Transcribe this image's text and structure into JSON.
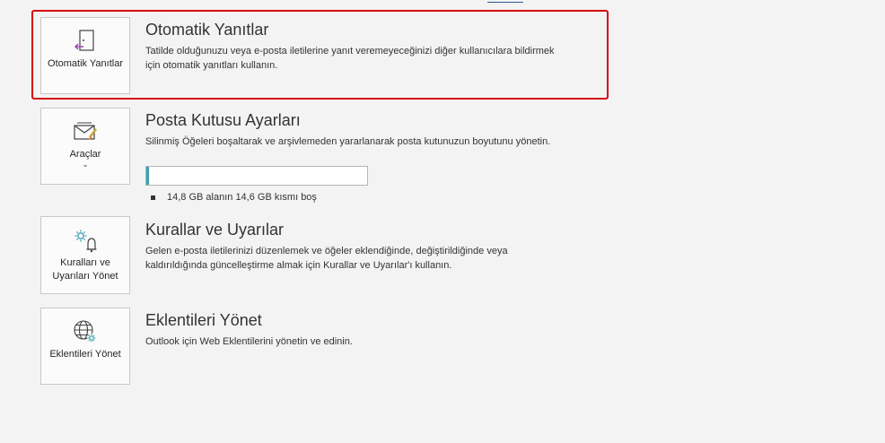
{
  "sections": [
    {
      "tile_label": "Otomatik Yanıtlar",
      "title": "Otomatik Yanıtlar",
      "description": "Tatilde olduğunuzu veya e-posta iletilerine yanıt veremeyeceğinizi diğer kullanıcılara bildirmek için otomatik yanıtları kullanın.",
      "icon": "auto-reply-door-icon"
    },
    {
      "tile_label": "Araçlar",
      "title": "Posta Kutusu Ayarları",
      "description": "Silinmiş Öğeleri boşaltarak ve arşivlemeden yararlanarak posta kutunuzun boyutunu yönetin.",
      "icon": "mailbox-tools-icon",
      "has_dropdown": true,
      "usage_text": "14,8 GB alanın 14,6 GB kısmı boş",
      "usage_fraction": 0.014
    },
    {
      "tile_label": "Kuralları ve Uyarıları Yönet",
      "title": "Kurallar ve Uyarılar",
      "description": "Gelen e-posta iletilerinizi düzenlemek ve öğeler eklendiğinde, değiştirildiğinde veya kaldırıldığında güncelleştirme almak için Kurallar ve Uyarılar'ı kullanın.",
      "icon": "rules-alerts-icon"
    },
    {
      "tile_label": "Eklentileri Yönet",
      "title": "Eklentileri Yönet",
      "description": "Outlook için Web Eklentilerini yönetin ve edinin.",
      "icon": "globe-gear-icon"
    }
  ],
  "colors": {
    "highlight": "#d6050f",
    "accent_purple": "#9b3fb5",
    "accent_teal": "#3aa0b4",
    "usage_fill": "#3aa0b4"
  }
}
